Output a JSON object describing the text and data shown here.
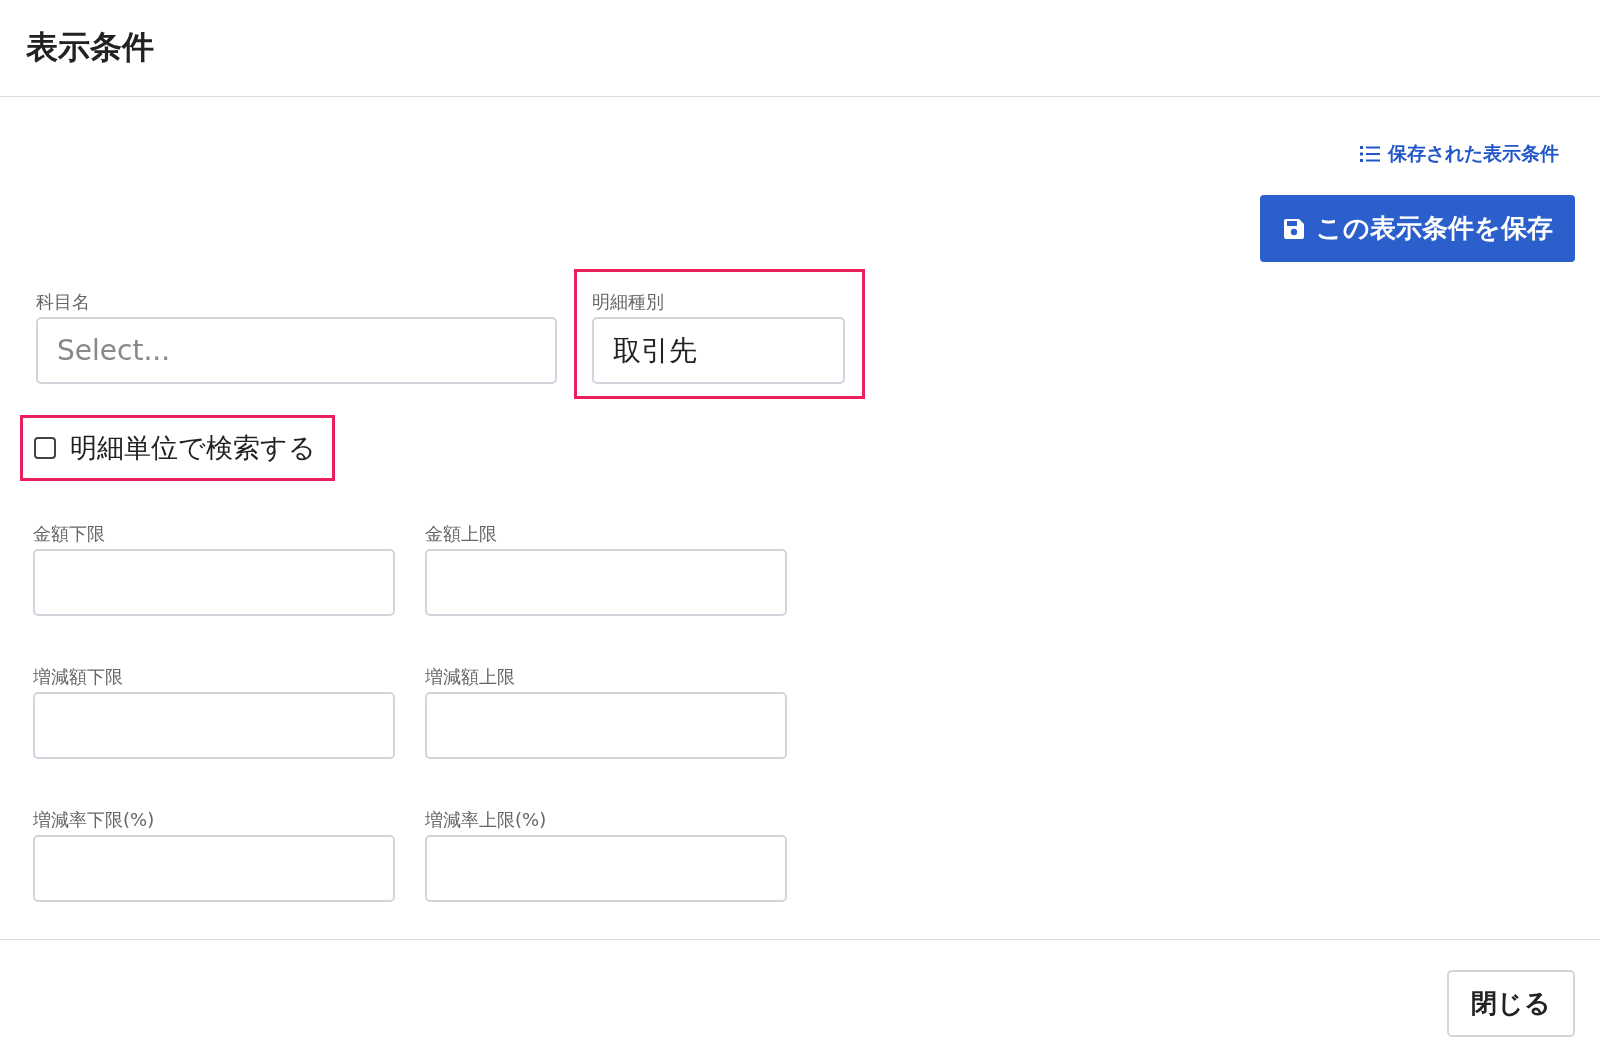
{
  "title": "表示条件",
  "saved_conditions_link": "保存された表示条件",
  "save_button": "この表示条件を保存",
  "account_field": {
    "label": "科目名",
    "placeholder": "Select..."
  },
  "detail_type_field": {
    "label": "明細種別",
    "value": "取引先",
    "highlighted": true
  },
  "detail_search_checkbox": {
    "label": "明細単位で検索する",
    "checked": false,
    "highlighted": true
  },
  "range_fields": [
    {
      "label": "金額下限"
    },
    {
      "label": "金額上限"
    },
    {
      "label": "増減額下限"
    },
    {
      "label": "増減額上限"
    },
    {
      "label": "増減率下限(%)"
    },
    {
      "label": "増減率上限(%)"
    }
  ],
  "close_button": "閉じる"
}
